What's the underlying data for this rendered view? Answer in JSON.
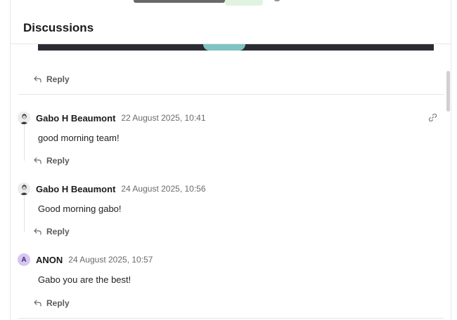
{
  "discussions": {
    "title": "Discussions"
  },
  "reply_label": "Reply",
  "comments": [
    {
      "author": "Gabo H Beaumont",
      "timestamp": "22 August 2025, 10:41",
      "body": "good morning team!",
      "avatar_type": "photo"
    },
    {
      "author": "Gabo H Beaumont",
      "timestamp": "24 August 2025, 10:56",
      "body": "Good morning gabo!",
      "avatar_type": "photo"
    },
    {
      "author": "ANON",
      "timestamp": "24 August 2025, 10:57",
      "body": "Gabo you are the best!",
      "avatar_type": "letter",
      "avatar_letter": "A"
    }
  ],
  "icons": {
    "reply": "reply-arrow-icon",
    "link": "link-icon"
  },
  "colors": {
    "divider": "#e6e6e6",
    "anon_avatar_bg": "#d7c6f2",
    "anon_avatar_fg": "#3d2a6e",
    "media_teal": "#7fc4c0"
  }
}
